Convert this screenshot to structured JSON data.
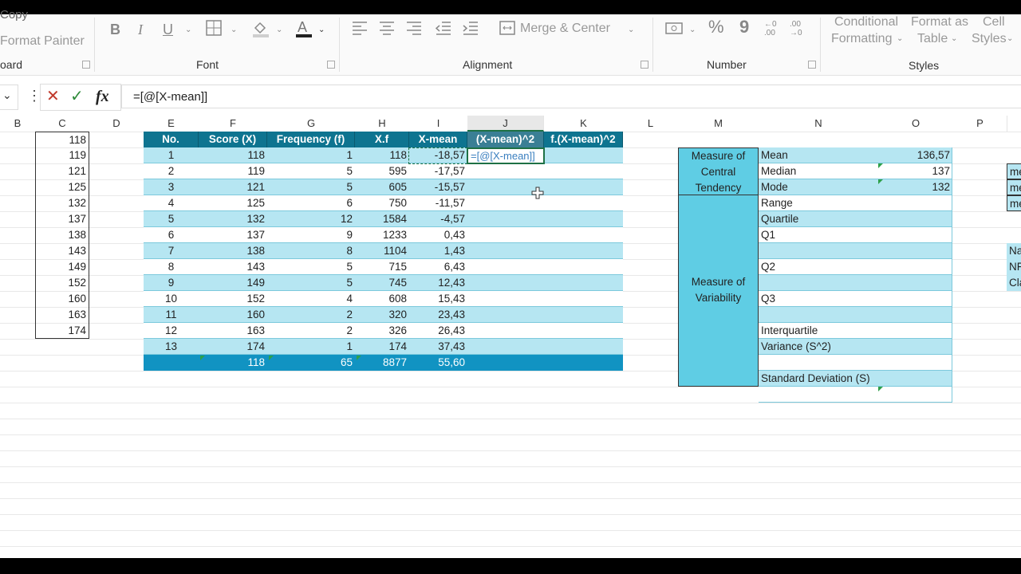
{
  "ribbon": {
    "clipboard_copy": "Copy",
    "format_painter": "Format Painter",
    "clipboard_label": "oard",
    "font_label": "Font",
    "alignment_label": "Alignment",
    "number_label": "Number",
    "styles_label": "Styles",
    "merge_center": "Merge & Center",
    "cond_format_1": "Conditional",
    "cond_format_2": "Formatting",
    "format_table_1": "Format as",
    "format_table_2": "Table",
    "cell_styles_1": "Cell",
    "cell_styles_2": "Styles",
    "bold": "B",
    "italic": "I",
    "underline": "U",
    "percent": "%",
    "comma": "9",
    "inc_dec": "←0 .00",
    "dec_dec": ".00 →0"
  },
  "formula_bar": {
    "cancel": "✕",
    "enter": "✓",
    "fx": "fx",
    "formula": "=[@[X-mean]]"
  },
  "columns": [
    "B",
    "C",
    "D",
    "E",
    "F",
    "G",
    "H",
    "I",
    "J",
    "K",
    "L",
    "M",
    "N",
    "O",
    "P"
  ],
  "col_c_values": [
    "118",
    "119",
    "121",
    "125",
    "132",
    "137",
    "138",
    "143",
    "149",
    "152",
    "160",
    "163",
    "174"
  ],
  "table": {
    "headers": [
      "No.",
      "Score (X)",
      "Frequency (f)",
      "X.f",
      "X-mean",
      "(X-mean)^2",
      "f.(X-mean)^2"
    ],
    "rows": [
      [
        "1",
        "118",
        "1",
        "118",
        "-18,57"
      ],
      [
        "2",
        "119",
        "5",
        "595",
        "-17,57"
      ],
      [
        "3",
        "121",
        "5",
        "605",
        "-15,57"
      ],
      [
        "4",
        "125",
        "6",
        "750",
        "-11,57"
      ],
      [
        "5",
        "132",
        "12",
        "1584",
        "-4,57"
      ],
      [
        "6",
        "137",
        "9",
        "1233",
        "0,43"
      ],
      [
        "7",
        "138",
        "8",
        "1104",
        "1,43"
      ],
      [
        "8",
        "143",
        "5",
        "715",
        "6,43"
      ],
      [
        "9",
        "149",
        "5",
        "745",
        "12,43"
      ],
      [
        "10",
        "152",
        "4",
        "608",
        "15,43"
      ],
      [
        "11",
        "160",
        "2",
        "320",
        "23,43"
      ],
      [
        "12",
        "163",
        "2",
        "326",
        "26,43"
      ],
      [
        "13",
        "174",
        "1",
        "174",
        "37,43"
      ]
    ],
    "total": [
      "",
      "118",
      "65",
      "8877",
      "55,60"
    ],
    "editing_cell": "=[@[X-mean]]"
  },
  "stats": {
    "central_label_1": "Measure of",
    "central_label_2": "Central",
    "central_label_3": "Tendency",
    "variability_label_1": "Measure of",
    "variability_label_2": "Variability",
    "mean_label": "Mean",
    "mean_value": "136,57",
    "median_label": "Median",
    "median_value": "137",
    "mode_label": "Mode",
    "mode_value": "132",
    "range_label": "Range",
    "quartile_label": "Quartile",
    "q1_label": "Q1",
    "q2_label": "Q2",
    "q3_label": "Q3",
    "interquartile_label": "Interquartile",
    "variance_label": "Variance (S^2)",
    "sd_label": "Standard Deviation (S)"
  },
  "right_edge": [
    "me",
    "me",
    "me",
    "Na",
    "NF",
    "Cla"
  ],
  "colors": {
    "header_dark": "#0e7490",
    "header_teal": "#1aa1c7",
    "band": "#b6e6f2",
    "stats_fill": "#5fcde4",
    "total": "#1193c2"
  }
}
